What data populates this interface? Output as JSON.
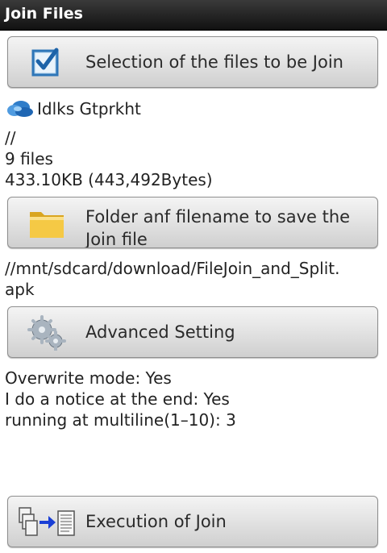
{
  "window": {
    "title": "Join Files"
  },
  "select_button": {
    "label": "Selection of the files to be Join",
    "icon": "checkbox-icon"
  },
  "file_info": {
    "name": "Idlks Gtprkht",
    "path": "//",
    "count": "9 files",
    "size": "433.10KB (443,492Bytes)"
  },
  "save_button": {
    "label_line1": "Folder anf filename to save the",
    "label_line2": "Join file",
    "icon": "folder-icon"
  },
  "save_path": {
    "line1": "//mnt/sdcard/download/FileJoin_and_Split.",
    "line2": "apk"
  },
  "advanced_button": {
    "label": "Advanced Setting",
    "icon": "gears-icon"
  },
  "settings": {
    "overwrite": "Overwrite mode: Yes",
    "notice": "I do a notice at the end: Yes",
    "multiline": "running at multiline(1–10): 3"
  },
  "execute_button": {
    "label": "Execution of Join",
    "icon": "join-documents-icon"
  }
}
